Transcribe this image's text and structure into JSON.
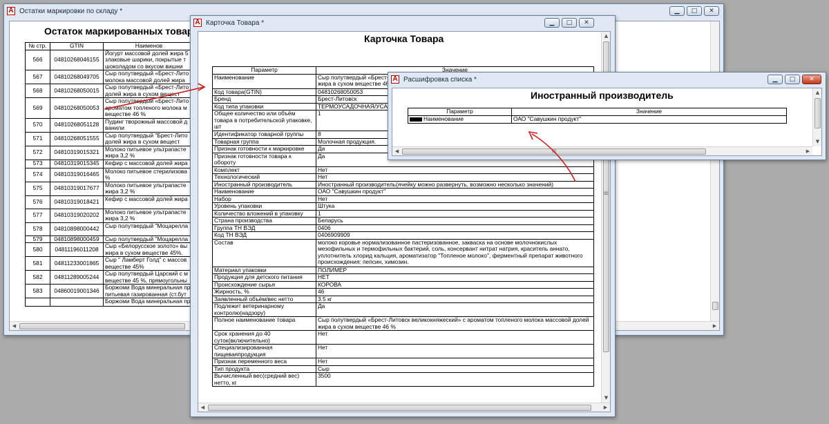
{
  "icons": {
    "app": "pdf-like-red-icon",
    "minimize": "minimize-icon",
    "maximize": "maximize-icon",
    "close": "close-icon"
  },
  "colors": {
    "arrow": "#cc1a1a",
    "titlebar": "#dfe8f3",
    "close_button": "#c03a1e"
  },
  "glyphs": {
    "app_icon": "A",
    "min": "▁",
    "max": "□",
    "close": "✕",
    "up": "▲",
    "down": "▼",
    "left": "◀",
    "right": "▶",
    "grip": "≡",
    "grip_h": "III"
  },
  "stock": {
    "window_title": "Остатки маркировки по складу  *",
    "doc_title": "Остаток маркированных товаров",
    "columns": [
      "№ стр.",
      "GTIN",
      "Наименов"
    ],
    "rows": [
      {
        "n": "566",
        "gtin": "04810268046155",
        "name": "Йогурт массовой долей жира 5 злаковые шарики,  покрытые т шоколадом со вкусом вишни"
      },
      {
        "n": "567",
        "gtin": "04810268049705",
        "name": "Сыр полутвердый «Брест-Лито молока массовой долей жира"
      },
      {
        "n": "568",
        "gtin": "04810268050015",
        "name": "Сыр полутвердый «Брест-Лито долей жира в сухом вещест"
      },
      {
        "n": "569",
        "gtin": "04810268050053",
        "name": "Сыр полутвердый «Брест-Лито ароматом топленого молока м веществе 46 %"
      },
      {
        "n": "570",
        "gtin": "04810268051128",
        "name": "Пудинг творожный массовой д ванили"
      },
      {
        "n": "571",
        "gtin": "04810268051555",
        "name": "Сыр полутвердый \"Брест-Лито долей жира в сухом вещест"
      },
      {
        "n": "572",
        "gtin": "04810319015321",
        "name": "Молоко питьевое ультрапасте жира 3,2 %"
      },
      {
        "n": "573",
        "gtin": "04810319015345",
        "name": "Кефир с массовой долей жира"
      },
      {
        "n": "574",
        "gtin": "04810319016465",
        "name": "Молоко питьевое стерилизова %"
      },
      {
        "n": "575",
        "gtin": "04810319017677",
        "name": "Молоко питьевое ультрапасте жира 3,2 %"
      },
      {
        "n": "576",
        "gtin": "04810319018421",
        "name": "Кефир с массовой долей жира"
      },
      {
        "n": "577",
        "gtin": "04810319020202",
        "name": "Молоко питьевое ультрапасте жира 3,2 %"
      },
      {
        "n": "578",
        "gtin": "04810898000442",
        "name": "Сыр полутвердый \"Моцарелла"
      },
      {
        "n": "579",
        "gtin": "04810898000459",
        "name": "Сыр полутвердый \"Моцарелла"
      },
      {
        "n": "580",
        "gtin": "04811196011208",
        "name": "Сыр «Белорусское золото» вы жира в сухом веществе 45%."
      },
      {
        "n": "581",
        "gtin": "04811233001865",
        "name": "Сыр \" Ламберт Голд\" с массов веществе 45%"
      },
      {
        "n": "582",
        "gtin": "04811289005244",
        "name": "Сыр полутвердый Царский с м веществе 45 %, прямоугольны"
      },
      {
        "n": "583",
        "gtin": "04860019001346",
        "name": "Боржоми Вода минеральная пр питьевая газированная (ст.бут"
      },
      {
        "n": "",
        "gtin": "",
        "name": "Боржоми Вода минеральная пр"
      }
    ]
  },
  "card": {
    "window_title": "Карточка Товара  *",
    "doc_title": "Карточка Товара",
    "columns": [
      "Параметр",
      "Значение"
    ],
    "rows": [
      {
        "p": "Наименование",
        "v": "Сыр полутвердый «Брест-Литовск великокняжеский» с ароматом топленого молока массовой долей жира в сухом веществе 46 %"
      },
      {
        "p": "Код товара(GTIN)",
        "v": "04810268050053"
      },
      {
        "p": "Бренд",
        "v": "Брест-Литовск"
      },
      {
        "p": "Код типа упаковки",
        "v": "ТЕРМОУСАДОЧНАЯ/УСАДОЧНАЯ"
      },
      {
        "p": "Общее количество или объём товара в потребительской упаковке, шт",
        "v": "1"
      },
      {
        "p": "Идентификатор товарной группы",
        "v": "8"
      },
      {
        "p": "Товарная группа",
        "v": "Молочная продукция."
      },
      {
        "p": "Признак готовности к маркировке",
        "v": "Да"
      },
      {
        "p": "Признак готовности товара к обороту",
        "v": "Да"
      },
      {
        "p": "Комплект",
        "v": "Нет"
      },
      {
        "p": "Технологический",
        "v": "Нет"
      },
      {
        "p": "Иностранный производитель",
        "v": "Иностранный производитель(ячейку можно развернуть, возможно несколько значений)"
      },
      {
        "p": "Наименование",
        "v": "ОАО \"Савушкин продукт\""
      },
      {
        "p": "Набор",
        "v": "Нет"
      },
      {
        "p": "Уровень упаковки",
        "v": "Штука"
      },
      {
        "p": "Количество вложений в упаковку",
        "v": "1"
      },
      {
        "p": "Страна производства",
        "v": "Беларусь"
      },
      {
        "p": "Группа ТН ВЭД",
        "v": "0406"
      },
      {
        "p": "Код ТН ВЭД",
        "v": "0406909909"
      },
      {
        "p": "Состав",
        "v": "молоко коровье нормализованное пастеризованное, закваска на основе молочнокислых мезофильных и термофильных бактерий, соль, консервант нитрат натрия, краситель аннато, уплотнитель хлорид кальция, ароматизатор \"Топленое молоко\", ферментный препарат животного происхождения: пепсин, химозин."
      },
      {
        "p": "Материал упаковки",
        "v": "ПОЛИМЕР"
      },
      {
        "p": "Продукция для детского питания",
        "v": "НЕТ"
      },
      {
        "p": "Происхождение сырья",
        "v": "КОРОВА"
      },
      {
        "p": "Жирность, %",
        "v": "46"
      },
      {
        "p": "Заявленный объём/вес нетто",
        "v": "3.5 кг"
      },
      {
        "p": "Подлежит ветеринарному контролю(надзору)",
        "v": "Да"
      },
      {
        "p": "Полное наименование товара",
        "v": "Сыр полутвердый «Брест-Литовск великокняжеский» с ароматом топленого молока массовой долей жира в сухом веществе 46 %"
      },
      {
        "p": "Срок хранения до 40 суток(включительно)",
        "v": "Нет"
      },
      {
        "p": "Специализированная пищеваяпродукция",
        "v": "Нет"
      },
      {
        "p": "Признак переменного веса",
        "v": "Нет"
      },
      {
        "p": "Тип продукта",
        "v": "Сыр"
      },
      {
        "p": "Вычисленный вес(средний вес) нетто, кг",
        "v": "3500"
      }
    ]
  },
  "decode": {
    "window_title": "Расшифровка списка  *",
    "doc_title": "Иностранный производитель",
    "columns": [
      "Параметр",
      "Значение"
    ],
    "rows": [
      {
        "p": "Наименование",
        "v": "ОАО \"Савушкин продукт\""
      }
    ]
  }
}
